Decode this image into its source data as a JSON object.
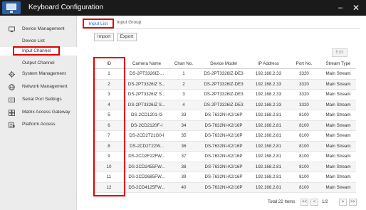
{
  "window": {
    "title": "Keyboard Configuration",
    "min_symbol": "–",
    "close_symbol": "✕"
  },
  "sidebar": {
    "items": [
      {
        "label": "Device Management",
        "icon": "device-management-icon"
      },
      {
        "label": "System Management",
        "icon": "gear-icon"
      },
      {
        "label": "Network Management",
        "icon": "globe-icon"
      },
      {
        "label": "Serial Port Settings",
        "icon": "serial-port-icon"
      },
      {
        "label": "Matrix Access Gateway",
        "icon": "grid-icon"
      },
      {
        "label": "Platform Access",
        "icon": "platform-icon"
      }
    ],
    "sub_items": [
      {
        "label": "Device List"
      },
      {
        "label": "Input Channel",
        "active": true
      },
      {
        "label": "Output Channel"
      }
    ]
  },
  "tabs": [
    {
      "label": "Input List",
      "active": true
    },
    {
      "label": "Input Group",
      "active": false
    }
  ],
  "toolbar": {
    "import_label": "Import",
    "export_label": "Export",
    "edit_label": "Edit"
  },
  "table": {
    "headers": [
      "ID",
      "Camera Name",
      "Chan No.",
      "Device Model",
      "IP Address",
      "Port No.",
      "Stream Type"
    ],
    "rows": [
      [
        "1",
        "DS-2PT3326IZ-...",
        "1",
        "DS-2PT3326IZ-DE3",
        "192.168.2.33",
        "3320",
        "Main Stream"
      ],
      [
        "2",
        "DS-2PT3326IZ S...",
        "2",
        "DS-2PT3326IZ-DE3",
        "192.168.2.33",
        "3320",
        "Main Stream"
      ],
      [
        "3",
        "DS-2PT3326IZ S...",
        "3",
        "DS-2PT3326IZ-DE3",
        "192.168.2.33",
        "3320",
        "Main Stream"
      ],
      [
        "4",
        "DS-2PT3326IZ S...",
        "4",
        "DS-2PT3326IZ-DE3",
        "192.168.2.33",
        "3320",
        "Main Stream"
      ],
      [
        "5",
        "DS-2CD1201-I3",
        "33",
        "DS-7632NI-K2/16P",
        "192.168.2.81",
        "8100",
        "Main Stream"
      ],
      [
        "6",
        "DS-2CD2120F-I",
        "34",
        "DS-7632NI-K2/16P",
        "192.168.2.81",
        "8100",
        "Main Stream"
      ],
      [
        "7",
        "DS-2CD2T21G0-I",
        "35",
        "DS-7632NI-K2/16P",
        "192.168.2.81",
        "8100",
        "Main Stream"
      ],
      [
        "8",
        "DS-2CD2T22W...",
        "36",
        "DS-7632NI-K2/16P",
        "192.168.2.81",
        "8100",
        "Main Stream"
      ],
      [
        "9",
        "DS-2CD2F22FW...",
        "37",
        "DS-7632NI-K2/16P",
        "192.168.2.81",
        "8100",
        "Main Stream"
      ],
      [
        "10",
        "DS-2CD2455FW...",
        "38",
        "DS-7632NI-K2/16P",
        "192.168.2.81",
        "8100",
        "Main Stream"
      ],
      [
        "11",
        "DS-2CD2685FW...",
        "39",
        "DS-7632NI-K2/16P",
        "192.168.2.81",
        "8100",
        "Main Stream"
      ],
      [
        "12",
        "DS-2CD4125FW...",
        "40",
        "DS-7632NI-K2/16P",
        "192.168.2.81",
        "8100",
        "Main Stream"
      ]
    ]
  },
  "pagination": {
    "total_text": "Total 22 Items",
    "first": "<<",
    "prev": "<",
    "page": "1/2",
    "next": ">",
    "last": ">>"
  },
  "colors": {
    "titlebar": "#1a1a1a",
    "highlight": "#e00000",
    "accent": "#2a6fc9"
  }
}
